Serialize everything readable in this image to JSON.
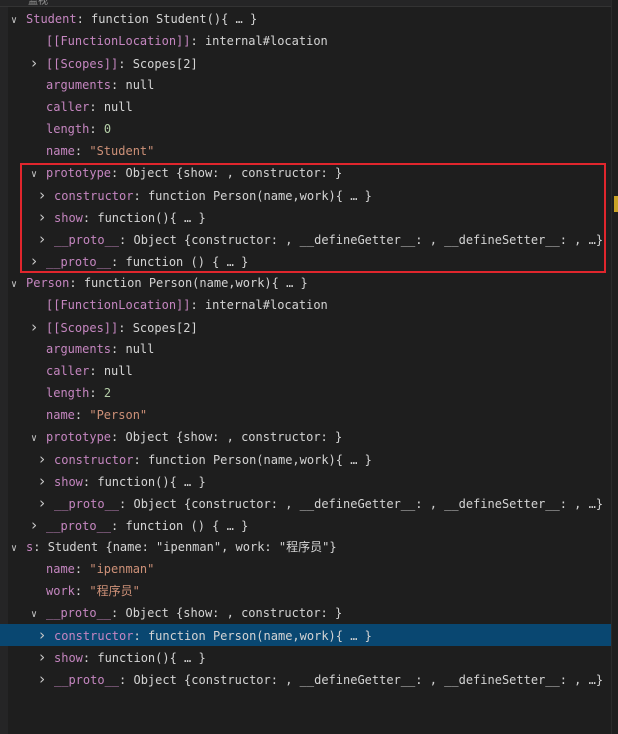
{
  "header": {
    "title": "监视"
  },
  "rows": [
    {
      "key": "Student",
      "value": "function Student(){ … }",
      "vtype": "val",
      "chev": "down",
      "indent": 0,
      "interactive": true
    },
    {
      "key": "[[FunctionLocation]]",
      "value": "internal#location",
      "vtype": "val",
      "chev": "none",
      "indent": 1
    },
    {
      "key": "[[Scopes]]",
      "value": "Scopes[2]",
      "vtype": "val",
      "chev": "right",
      "indent": 1
    },
    {
      "key": "arguments",
      "value": "null",
      "vtype": "val",
      "chev": "none",
      "indent": 1
    },
    {
      "key": "caller",
      "value": "null",
      "vtype": "val",
      "chev": "none",
      "indent": 1
    },
    {
      "key": "length",
      "value": "0",
      "vtype": "num",
      "chev": "none",
      "indent": 1
    },
    {
      "key": "name",
      "value": "\"Student\"",
      "vtype": "str",
      "chev": "none",
      "indent": 1
    },
    {
      "key": "prototype",
      "value": "Object {show: , constructor: }",
      "vtype": "val",
      "chev": "down",
      "indent": 1
    },
    {
      "key": "constructor",
      "value": "function Person(name,work){ … }",
      "vtype": "val",
      "chev": "right",
      "indent": 2
    },
    {
      "key": "show",
      "value": "function(){ … }",
      "vtype": "val",
      "chev": "right",
      "indent": 2
    },
    {
      "key": "__proto__",
      "value": "Object {constructor: , __defineGetter__: , __defineSetter__: , …}",
      "vtype": "val",
      "chev": "right",
      "indent": 2
    },
    {
      "key": "__proto__",
      "value": "function () { … }",
      "vtype": "val",
      "chev": "right",
      "indent": 1
    },
    {
      "key": "Person",
      "value": "function Person(name,work){ … }",
      "vtype": "val",
      "chev": "down",
      "indent": 0
    },
    {
      "key": "[[FunctionLocation]]",
      "value": "internal#location",
      "vtype": "val",
      "chev": "none",
      "indent": 1
    },
    {
      "key": "[[Scopes]]",
      "value": "Scopes[2]",
      "vtype": "val",
      "chev": "right",
      "indent": 1
    },
    {
      "key": "arguments",
      "value": "null",
      "vtype": "val",
      "chev": "none",
      "indent": 1
    },
    {
      "key": "caller",
      "value": "null",
      "vtype": "val",
      "chev": "none",
      "indent": 1
    },
    {
      "key": "length",
      "value": "2",
      "vtype": "num",
      "chev": "none",
      "indent": 1
    },
    {
      "key": "name",
      "value": "\"Person\"",
      "vtype": "str",
      "chev": "none",
      "indent": 1
    },
    {
      "key": "prototype",
      "value": "Object {show: , constructor: }",
      "vtype": "val",
      "chev": "down",
      "indent": 1
    },
    {
      "key": "constructor",
      "value": "function Person(name,work){ … }",
      "vtype": "val",
      "chev": "right",
      "indent": 2
    },
    {
      "key": "show",
      "value": "function(){ … }",
      "vtype": "val",
      "chev": "right",
      "indent": 2
    },
    {
      "key": "__proto__",
      "value": "Object {constructor: , __defineGetter__: , __defineSetter__: , …}",
      "vtype": "val",
      "chev": "right",
      "indent": 2
    },
    {
      "key": "__proto__",
      "value": "function () { … }",
      "vtype": "val",
      "chev": "right",
      "indent": 1
    },
    {
      "key": "s",
      "value": "Student {name: \"ipenman\", work: \"程序员\"}",
      "vtype": "val",
      "chev": "down",
      "indent": 0
    },
    {
      "key": "name",
      "value": "\"ipenman\"",
      "vtype": "str",
      "chev": "none",
      "indent": 1
    },
    {
      "key": "work",
      "value": "\"程序员\"",
      "vtype": "str",
      "chev": "none",
      "indent": 1
    },
    {
      "key": "__proto__",
      "value": "Object {show: , constructor: }",
      "vtype": "val",
      "chev": "down",
      "indent": 1
    },
    {
      "key": "constructor",
      "value": "function Person(name,work){ … }",
      "vtype": "val",
      "chev": "right",
      "indent": 2,
      "selected": true
    },
    {
      "key": "show",
      "value": "function(){ … }",
      "vtype": "val",
      "chev": "right",
      "indent": 2
    },
    {
      "key": "__proto__",
      "value": "Object {constructor: , __defineGetter__: , __defineSetter__: , …}",
      "vtype": "val",
      "chev": "right",
      "indent": 2
    }
  ],
  "highlight": {
    "color": "#e0262d"
  },
  "colors": {
    "key": "#c586c0",
    "string": "#ce9178",
    "number": "#b5cea8",
    "selected": "#094771"
  }
}
